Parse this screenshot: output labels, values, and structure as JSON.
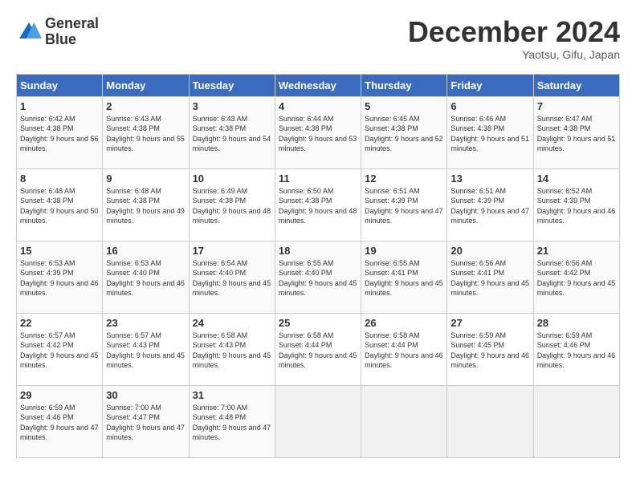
{
  "header": {
    "logo_line1": "General",
    "logo_line2": "Blue",
    "month": "December 2024",
    "location": "Yaotsu, Gifu, Japan"
  },
  "weekdays": [
    "Sunday",
    "Monday",
    "Tuesday",
    "Wednesday",
    "Thursday",
    "Friday",
    "Saturday"
  ],
  "weeks": [
    [
      {
        "day": "1",
        "sunrise": "6:42 AM",
        "sunset": "4:38 PM",
        "daylight": "9 hours and 56 minutes."
      },
      {
        "day": "2",
        "sunrise": "6:43 AM",
        "sunset": "4:38 PM",
        "daylight": "9 hours and 55 minutes."
      },
      {
        "day": "3",
        "sunrise": "6:43 AM",
        "sunset": "4:38 PM",
        "daylight": "9 hours and 54 minutes."
      },
      {
        "day": "4",
        "sunrise": "6:44 AM",
        "sunset": "4:38 PM",
        "daylight": "9 hours and 53 minutes."
      },
      {
        "day": "5",
        "sunrise": "6:45 AM",
        "sunset": "4:38 PM",
        "daylight": "9 hours and 52 minutes."
      },
      {
        "day": "6",
        "sunrise": "6:46 AM",
        "sunset": "4:38 PM",
        "daylight": "9 hours and 51 minutes."
      },
      {
        "day": "7",
        "sunrise": "6:47 AM",
        "sunset": "4:38 PM",
        "daylight": "9 hours and 51 minutes."
      }
    ],
    [
      {
        "day": "8",
        "sunrise": "6:48 AM",
        "sunset": "4:38 PM",
        "daylight": "9 hours and 50 minutes."
      },
      {
        "day": "9",
        "sunrise": "6:48 AM",
        "sunset": "4:38 PM",
        "daylight": "9 hours and 49 minutes."
      },
      {
        "day": "10",
        "sunrise": "6:49 AM",
        "sunset": "4:38 PM",
        "daylight": "9 hours and 48 minutes."
      },
      {
        "day": "11",
        "sunrise": "6:50 AM",
        "sunset": "4:38 PM",
        "daylight": "9 hours and 48 minutes."
      },
      {
        "day": "12",
        "sunrise": "6:51 AM",
        "sunset": "4:39 PM",
        "daylight": "9 hours and 47 minutes."
      },
      {
        "day": "13",
        "sunrise": "6:51 AM",
        "sunset": "4:39 PM",
        "daylight": "9 hours and 47 minutes."
      },
      {
        "day": "14",
        "sunrise": "6:52 AM",
        "sunset": "4:39 PM",
        "daylight": "9 hours and 46 minutes."
      }
    ],
    [
      {
        "day": "15",
        "sunrise": "6:53 AM",
        "sunset": "4:39 PM",
        "daylight": "9 hours and 46 minutes."
      },
      {
        "day": "16",
        "sunrise": "6:53 AM",
        "sunset": "4:40 PM",
        "daylight": "9 hours and 46 minutes."
      },
      {
        "day": "17",
        "sunrise": "6:54 AM",
        "sunset": "4:40 PM",
        "daylight": "9 hours and 45 minutes."
      },
      {
        "day": "18",
        "sunrise": "6:55 AM",
        "sunset": "4:40 PM",
        "daylight": "9 hours and 45 minutes."
      },
      {
        "day": "19",
        "sunrise": "6:55 AM",
        "sunset": "4:41 PM",
        "daylight": "9 hours and 45 minutes."
      },
      {
        "day": "20",
        "sunrise": "6:56 AM",
        "sunset": "4:41 PM",
        "daylight": "9 hours and 45 minutes."
      },
      {
        "day": "21",
        "sunrise": "6:56 AM",
        "sunset": "4:42 PM",
        "daylight": "9 hours and 45 minutes."
      }
    ],
    [
      {
        "day": "22",
        "sunrise": "6:57 AM",
        "sunset": "4:42 PM",
        "daylight": "9 hours and 45 minutes."
      },
      {
        "day": "23",
        "sunrise": "6:57 AM",
        "sunset": "4:43 PM",
        "daylight": "9 hours and 45 minutes."
      },
      {
        "day": "24",
        "sunrise": "6:58 AM",
        "sunset": "4:43 PM",
        "daylight": "9 hours and 45 minutes."
      },
      {
        "day": "25",
        "sunrise": "6:58 AM",
        "sunset": "4:44 PM",
        "daylight": "9 hours and 45 minutes."
      },
      {
        "day": "26",
        "sunrise": "6:58 AM",
        "sunset": "4:44 PM",
        "daylight": "9 hours and 46 minutes."
      },
      {
        "day": "27",
        "sunrise": "6:59 AM",
        "sunset": "4:45 PM",
        "daylight": "9 hours and 46 minutes."
      },
      {
        "day": "28",
        "sunrise": "6:59 AM",
        "sunset": "4:46 PM",
        "daylight": "9 hours and 46 minutes."
      }
    ],
    [
      {
        "day": "29",
        "sunrise": "6:59 AM",
        "sunset": "4:46 PM",
        "daylight": "9 hours and 47 minutes."
      },
      {
        "day": "30",
        "sunrise": "7:00 AM",
        "sunset": "4:47 PM",
        "daylight": "9 hours and 47 minutes."
      },
      {
        "day": "31",
        "sunrise": "7:00 AM",
        "sunset": "4:48 PM",
        "daylight": "9 hours and 47 minutes."
      },
      null,
      null,
      null,
      null
    ]
  ]
}
